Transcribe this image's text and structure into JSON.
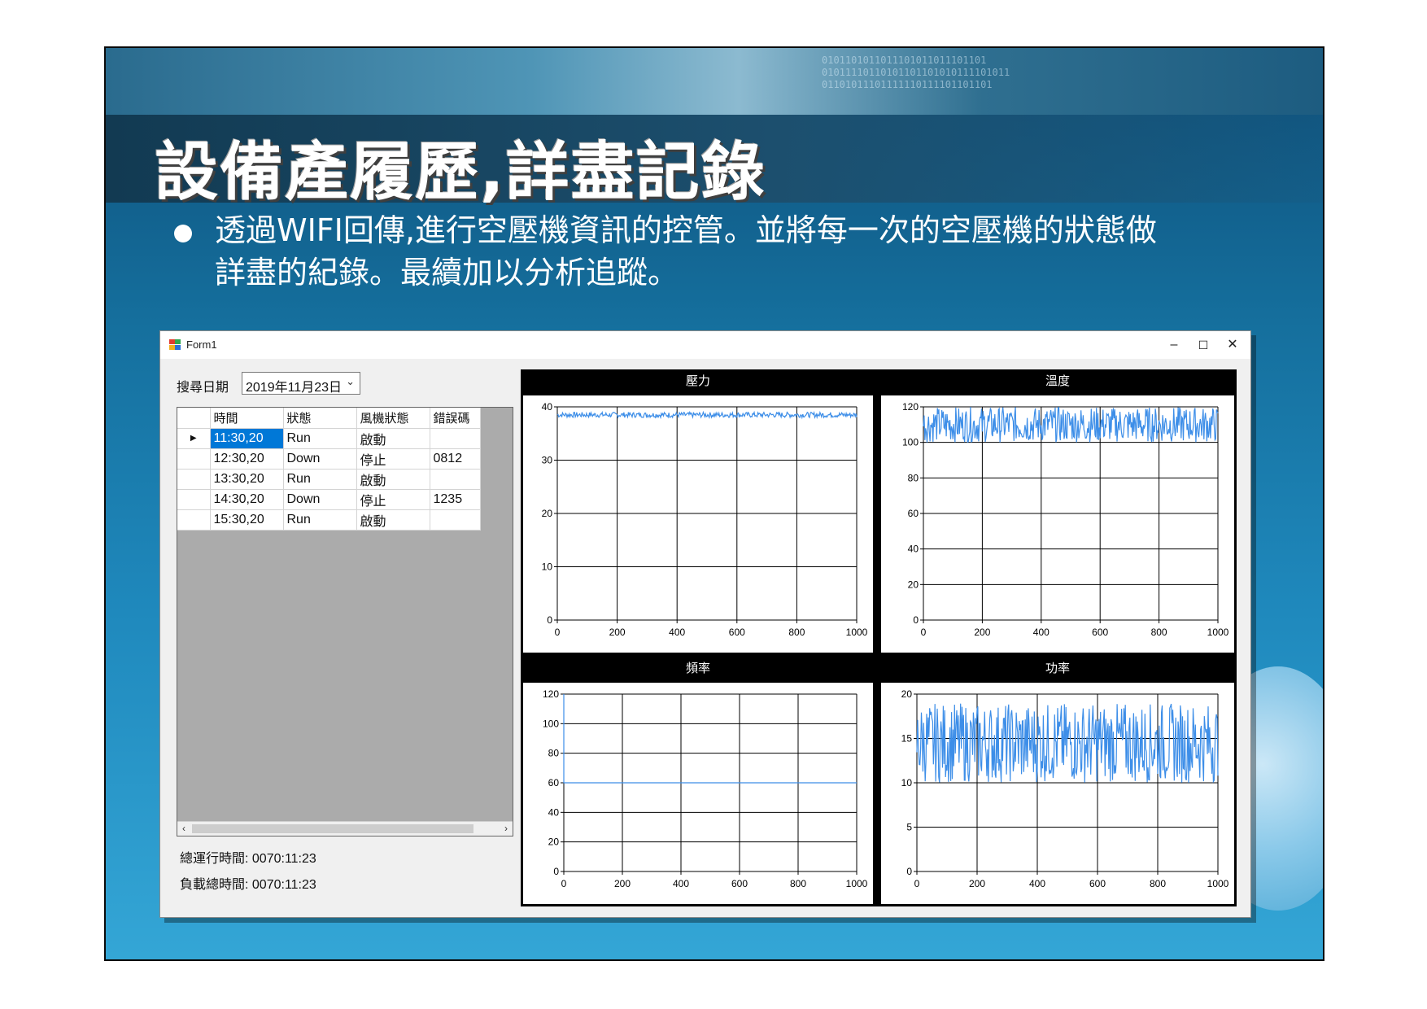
{
  "slide": {
    "title": "設備產履歷,詳盡記錄",
    "bullet_line1": "透過WIFI回傳,進行空壓機資訊的控管。並將每一次的空壓機的狀態做",
    "bullet_line2": "詳盡的紀錄。最續加以分析追蹤。"
  },
  "window": {
    "title": "Form1",
    "minimize": "–",
    "maximize": "☐",
    "close": "✕"
  },
  "search": {
    "label": "搜尋日期",
    "date_value": "2019年11月23日"
  },
  "table": {
    "headers": [
      "時間",
      "狀態",
      "風機狀態",
      "錯誤碼"
    ],
    "rows": [
      {
        "time": "11:30,20",
        "status": "Run",
        "fan": "啟動",
        "error": ""
      },
      {
        "time": "12:30,20",
        "status": "Down",
        "fan": "停止",
        "error": "0812"
      },
      {
        "time": "13:30,20",
        "status": "Run",
        "fan": "啟動",
        "error": ""
      },
      {
        "time": "14:30,20",
        "status": "Down",
        "fan": "停止",
        "error": "1235"
      },
      {
        "time": "15:30,20",
        "status": "Run",
        "fan": "啟動",
        "error": ""
      }
    ],
    "selected_row": 0
  },
  "summary": {
    "total_run_label": "總運行時間:",
    "total_run_value": "0070:11:23",
    "load_total_label": "負載總時間:",
    "load_total_value": "0070:11:23"
  },
  "colors": {
    "series": "#3d8ee8",
    "selection": "#0078d7"
  },
  "chart_data": [
    {
      "type": "line",
      "title": "壓力",
      "x_ticks": [
        0,
        200,
        400,
        600,
        800,
        1000
      ],
      "y_ticks": [
        0,
        10,
        20,
        30,
        40
      ],
      "xlim": [
        0,
        1000
      ],
      "ylim": [
        0,
        40
      ],
      "grid": true,
      "series": [
        {
          "x_range": [
            0,
            1000
          ],
          "y_min": 38,
          "y_max": 39,
          "pattern": "noise"
        }
      ]
    },
    {
      "type": "line",
      "title": "溫度",
      "x_ticks": [
        0,
        200,
        400,
        600,
        800,
        1000
      ],
      "y_ticks": [
        0,
        20,
        40,
        60,
        80,
        100,
        120
      ],
      "xlim": [
        0,
        1000
      ],
      "ylim": [
        0,
        120
      ],
      "grid": true,
      "series": [
        {
          "x_range": [
            0,
            1000
          ],
          "y_min": 100,
          "y_max": 120,
          "pattern": "noise"
        }
      ]
    },
    {
      "type": "line",
      "title": "頻率",
      "x_ticks": [
        0,
        200,
        400,
        600,
        800,
        1000
      ],
      "y_ticks": [
        0,
        20,
        40,
        60,
        80,
        100,
        120
      ],
      "xlim": [
        0,
        1000
      ],
      "ylim": [
        0,
        120
      ],
      "grid": true,
      "series": [
        {
          "x_range": [
            0,
            1000
          ],
          "y_min": 60,
          "y_max": 60,
          "pattern": "constant",
          "start_spike": 120
        }
      ]
    },
    {
      "type": "line",
      "title": "功率",
      "x_ticks": [
        0,
        200,
        400,
        600,
        800,
        1000
      ],
      "y_ticks": [
        0,
        5,
        10,
        15,
        20
      ],
      "xlim": [
        0,
        1000
      ],
      "ylim": [
        0,
        20
      ],
      "grid": true,
      "series": [
        {
          "x_range": [
            0,
            1000
          ],
          "y_min": 10,
          "y_max": 19,
          "pattern": "noise"
        }
      ]
    }
  ]
}
